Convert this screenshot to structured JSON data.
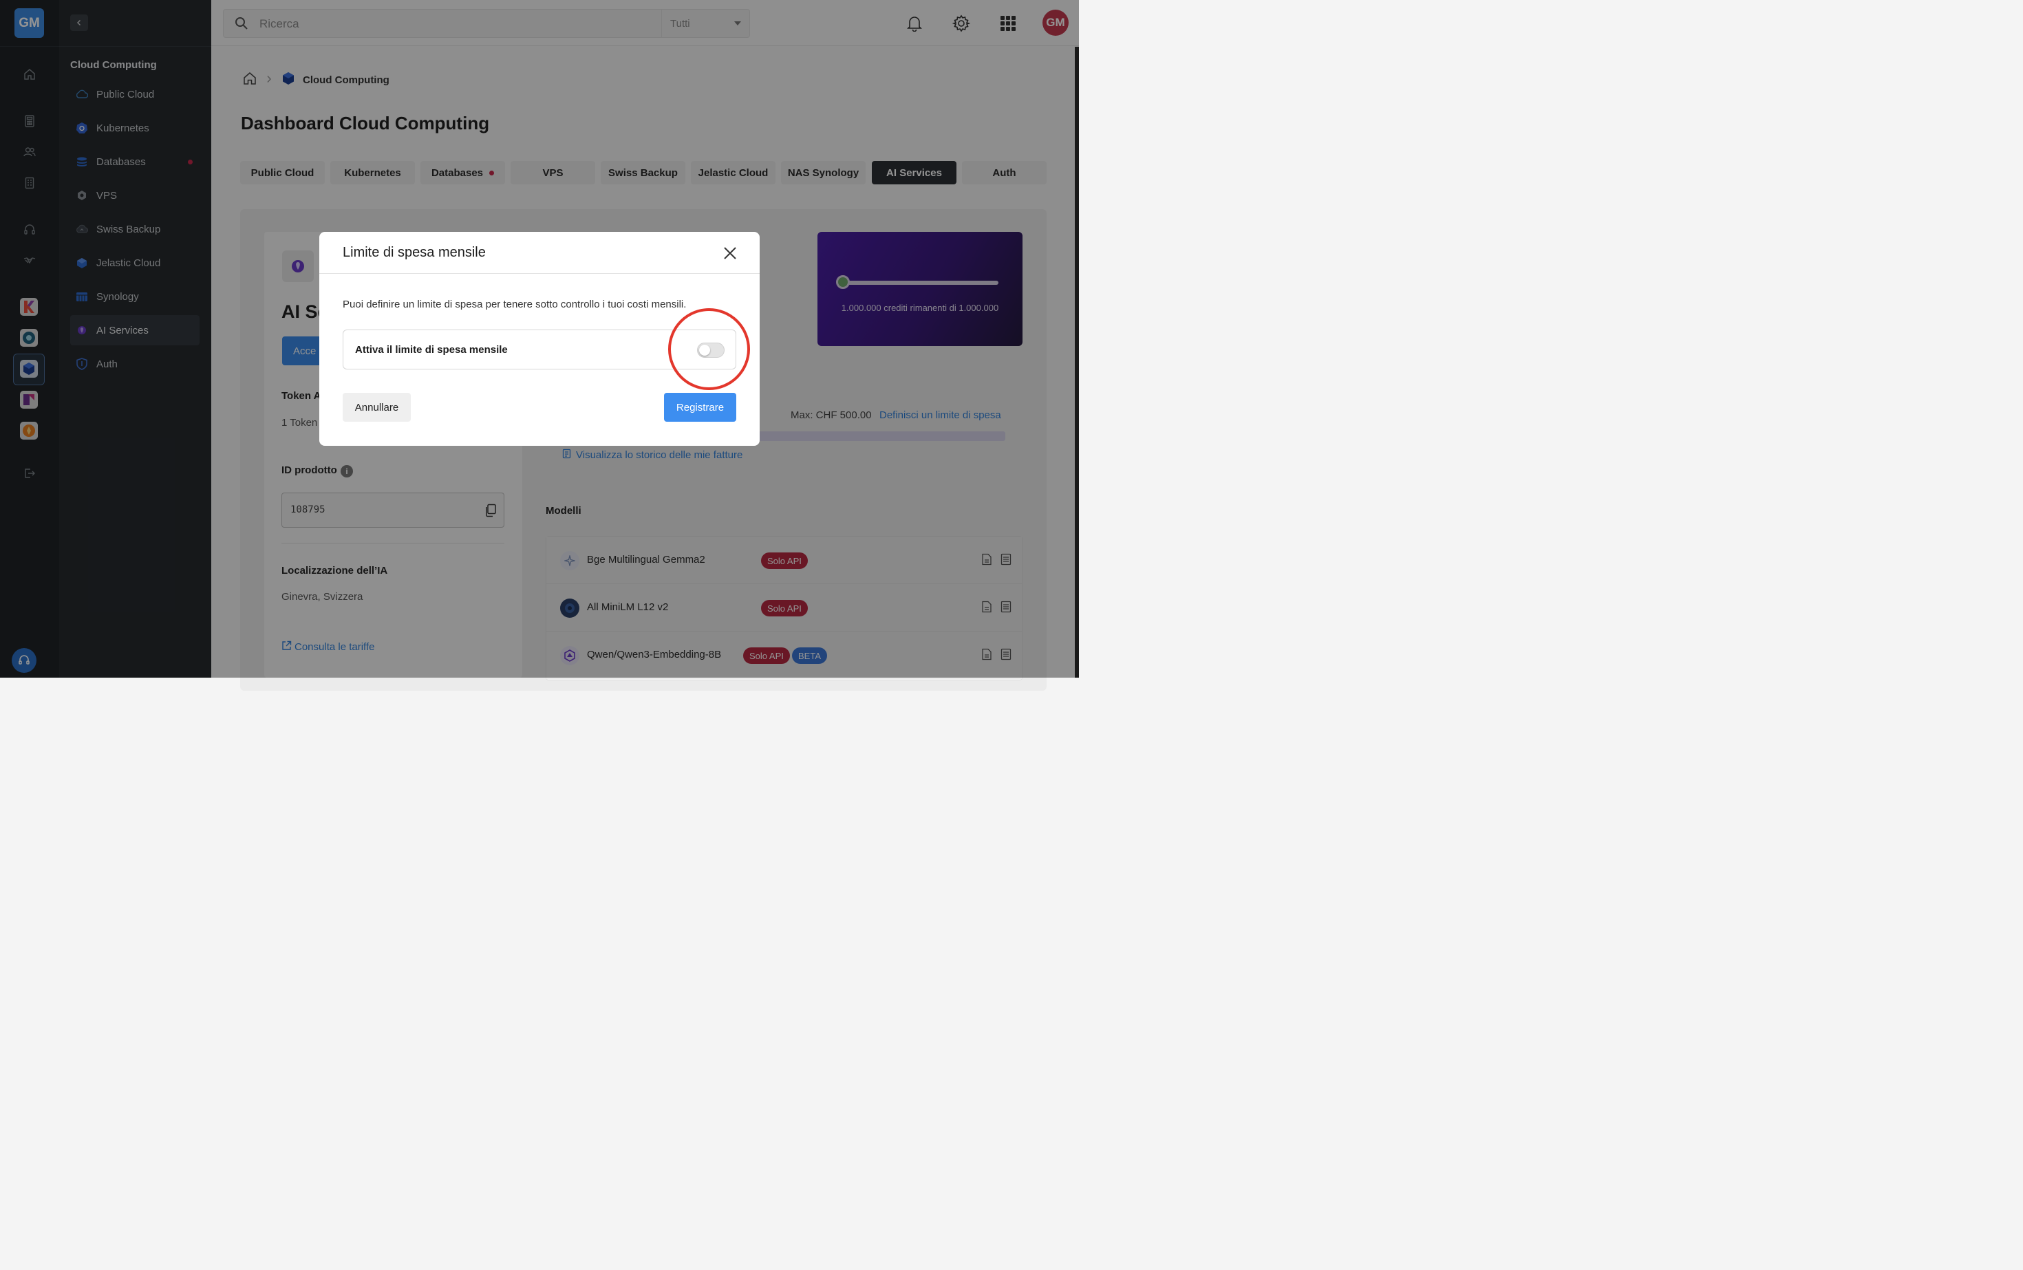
{
  "rail": {
    "logo": "GM"
  },
  "sidebar": {
    "section_title": "Cloud Computing",
    "items": [
      {
        "label": "Public Cloud",
        "icon": "cloud-icon"
      },
      {
        "label": "Kubernetes",
        "icon": "kubernetes-icon"
      },
      {
        "label": "Databases",
        "icon": "database-icon",
        "notification_dot": true
      },
      {
        "label": "VPS",
        "icon": "hexagon-icon"
      },
      {
        "label": "Swiss Backup",
        "icon": "cloud-backup-icon"
      },
      {
        "label": "Jelastic Cloud",
        "icon": "jelastic-icon"
      },
      {
        "label": "Synology",
        "icon": "synology-icon"
      },
      {
        "label": "AI Services",
        "icon": "ai-icon",
        "active": true
      },
      {
        "label": "Auth",
        "icon": "shield-icon"
      }
    ]
  },
  "topbar": {
    "search_placeholder": "Ricerca",
    "filter_value": "Tutti",
    "avatar": "GM"
  },
  "breadcrumb": {
    "current": "Cloud Computing"
  },
  "page": {
    "title": "Dashboard Cloud Computing"
  },
  "tabs": [
    {
      "label": "Public Cloud"
    },
    {
      "label": "Kubernetes"
    },
    {
      "label": "Databases",
      "dot": true
    },
    {
      "label": "VPS"
    },
    {
      "label": "Swiss Backup"
    },
    {
      "label": "Jelastic Cloud"
    },
    {
      "label": "NAS Synology"
    },
    {
      "label": "AI Services",
      "active": true
    },
    {
      "label": "Auth"
    }
  ],
  "left_card": {
    "title": "AI Se",
    "button": "Acce",
    "token_label": "Token A",
    "token_value": "1 Token",
    "product_id_label": "ID prodotto",
    "product_id": "108795",
    "location_label": "Localizzazione dell’IA",
    "location_value": "Ginevra, Svizzera",
    "tariff_link": "Consulta le tariffe"
  },
  "promo": {
    "credits_text": "1.000.000 crediti rimanenti di 1.000.000"
  },
  "billing": {
    "max_text": "Max: CHF 500.00",
    "define_limit_link": "Definisci un limite di spesa",
    "history_link": "Visualizza lo storico delle mie fatture"
  },
  "models": {
    "title": "Modelli",
    "items": [
      {
        "name": "Bge Multilingual Gemma2",
        "badges": [
          "Solo API"
        ]
      },
      {
        "name": "All MiniLM L12 v2",
        "badges": [
          "Solo API"
        ]
      },
      {
        "name": "Qwen/Qwen3-Embedding-8B",
        "badges": [
          "Solo API",
          "BETA"
        ]
      }
    ]
  },
  "modal": {
    "title": "Limite di spesa mensile",
    "description": "Puoi definire un limite di spesa per tenere sotto controllo i tuoi costi mensili.",
    "toggle_label": "Attiva il limite di spesa mensile",
    "toggle_on": false,
    "cancel": "Annullare",
    "save": "Registrare"
  },
  "colors": {
    "accent": "#3d8ef0",
    "highlight_circle": "#e3372c",
    "badge_red": "#b52840",
    "badge_blue": "#3b76d4"
  }
}
